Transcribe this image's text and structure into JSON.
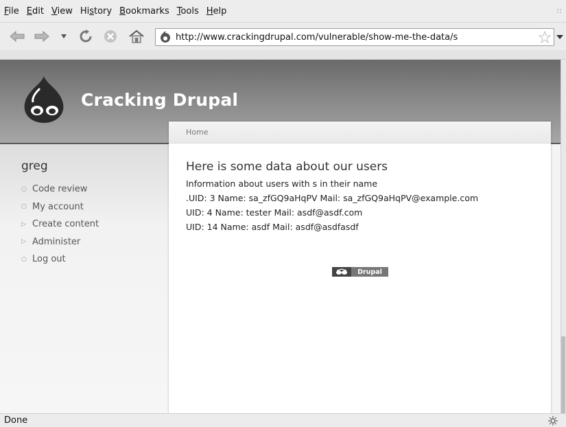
{
  "menu": [
    {
      "pre": "",
      "u": "F",
      "post": "ile"
    },
    {
      "pre": "",
      "u": "E",
      "post": "dit"
    },
    {
      "pre": "",
      "u": "V",
      "post": "iew"
    },
    {
      "pre": "Hi",
      "u": "s",
      "post": "tory"
    },
    {
      "pre": "",
      "u": "B",
      "post": "ookmarks"
    },
    {
      "pre": "",
      "u": "T",
      "post": "ools"
    },
    {
      "pre": "",
      "u": "H",
      "post": "elp"
    }
  ],
  "toolbar": {
    "back_icon": "back-arrow-icon",
    "forward_icon": "forward-arrow-icon",
    "history_dropdown_icon": "chevron-down-icon",
    "reload_icon": "reload-icon",
    "stop_icon": "stop-icon",
    "home_icon": "home-icon"
  },
  "address": {
    "url": "http://www.crackingdrupal.com/vulnerable/show-me-the-data/s",
    "site_icon": "drupal-favicon",
    "bookmark_icon": "star-icon"
  },
  "site": {
    "name": "Cracking Drupal",
    "logo_icon": "drupal-drop-logo"
  },
  "sidebar": {
    "user": "greg",
    "items": [
      {
        "label": "Code review",
        "bullet": "○"
      },
      {
        "label": "My account",
        "bullet": "○"
      },
      {
        "label": "Create content",
        "bullet": "▷"
      },
      {
        "label": "Administer",
        "bullet": "▷"
      },
      {
        "label": "Log out",
        "bullet": "○"
      }
    ]
  },
  "content": {
    "breadcrumb": "Home",
    "title": "Here is some data about our users",
    "subtitle": "Information about users with s in their name",
    "rows": [
      ".UID: 3 Name: sa_zfGQ9aHqPV Mail: sa_zfGQ9aHqPV@example.com",
      "UID: 4 Name: tester Mail: asdf@asdf.com",
      "UID: 14 Name: asdf Mail: asdf@asdfasdf"
    ],
    "powered_by": "Drupal"
  },
  "status": {
    "text": "Done",
    "icon": "gear-icon"
  },
  "colors": {
    "header_top": "#6a6a6a",
    "header_bottom": "#a8a8a8",
    "content_bg": "#ffffff"
  }
}
